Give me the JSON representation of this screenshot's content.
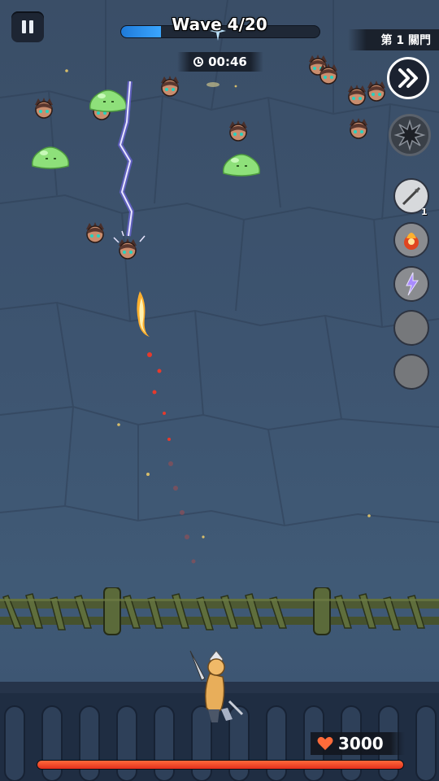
{
  "hud": {
    "wave_label": "Wave 4/20",
    "wave_progress": 0.2,
    "timer": "00:46",
    "gate_label": "第 1 關門",
    "hp_value": "3000",
    "hp_progress": 1.0
  },
  "skills": [
    {
      "name": "spear",
      "count": "1"
    },
    {
      "name": "fireball",
      "count": ""
    },
    {
      "name": "lightning",
      "count": ""
    },
    {
      "name": "empty",
      "count": ""
    },
    {
      "name": "empty",
      "count": ""
    }
  ],
  "colors": {
    "wave_fill": "#2a90f0",
    "hp_fill": "#ef3b24",
    "slime": "#8ee07a",
    "lightning": "#8a7bff",
    "fire": "#ff7b1c"
  }
}
